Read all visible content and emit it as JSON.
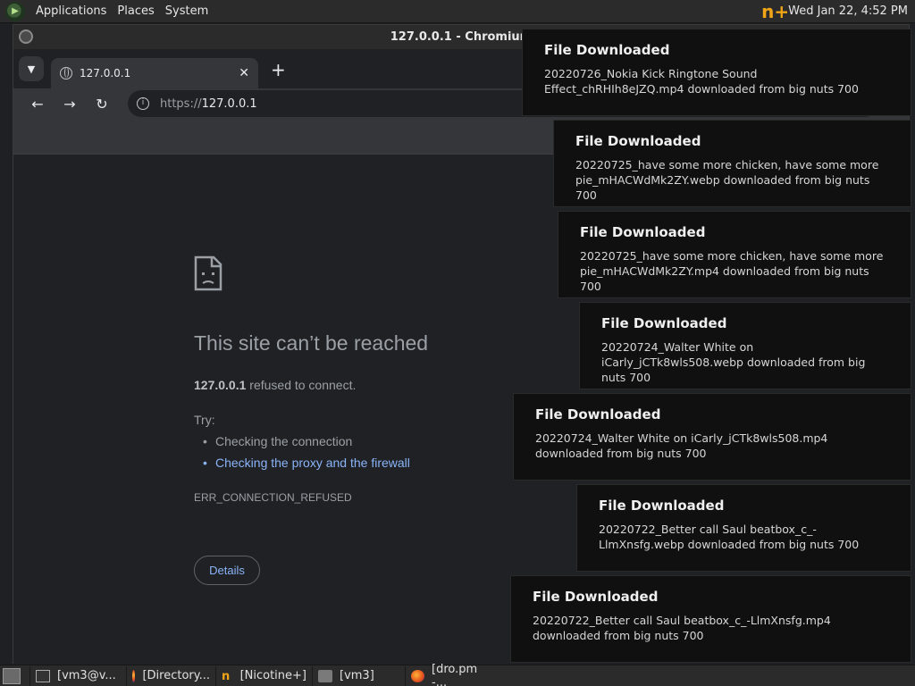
{
  "top_panel": {
    "menus": [
      "Applications",
      "Places",
      "System"
    ],
    "clock": "Wed Jan 22,  4:52 PM",
    "tray_icon": "nicotine-tray-icon"
  },
  "window": {
    "title": "127.0.0.1 - Chromium"
  },
  "tab": {
    "title": "127.0.0.1"
  },
  "omnibox": {
    "scheme": "https://",
    "host": "127.0.0.1"
  },
  "error": {
    "title": "This site can’t be reached",
    "host": "127.0.0.1",
    "desc": " refused to connect.",
    "try_label": "Try:",
    "suggestions": [
      "Checking the connection",
      "Checking the proxy and the firewall"
    ],
    "code": "ERR_CONNECTION_REFUSED",
    "details_label": "Details"
  },
  "notifications": [
    {
      "title": "File Downloaded",
      "body": "20220726_Nokia Kick Ringtone Sound Effect_chRHIh8eJZQ.mp4 downloaded from big nuts 700"
    },
    {
      "title": "File Downloaded",
      "body": "20220725_have some more chicken, have some more pie_mHACWdMk2ZY.webp downloaded from big nuts 700"
    },
    {
      "title": "File Downloaded",
      "body": "20220725_have some more chicken, have some more pie_mHACWdMk2ZY.mp4 downloaded from big nuts 700"
    },
    {
      "title": "File Downloaded",
      "body": "20220724_Walter White on iCarly_jCTk8wls508.webp downloaded from big nuts 700"
    },
    {
      "title": "File Downloaded",
      "body": "20220724_Walter White on iCarly_jCTk8wls508.mp4 downloaded from big nuts 700"
    },
    {
      "title": "File Downloaded",
      "body": "20220722_Better call Saul beatbox_c_-LlmXnsfg.webp downloaded from big nuts 700"
    },
    {
      "title": "File Downloaded",
      "body": "20220722_Better call Saul beatbox_c_-LlmXnsfg.mp4 downloaded from big nuts 700"
    }
  ],
  "taskbar": {
    "tasks": [
      "[vm3@v...",
      "[Directory...",
      "[Nicotine+]",
      "[vm3]",
      "[dro.pm -..."
    ]
  }
}
